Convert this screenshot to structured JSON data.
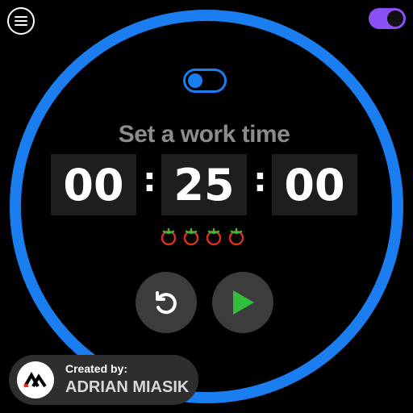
{
  "menu": {
    "icon": "hamburger-menu-icon"
  },
  "theme_toggle": {
    "state": "on",
    "color": "#8a4ff5"
  },
  "mode_toggle": {
    "state": "off",
    "color": "#1a7df0"
  },
  "timer": {
    "heading": "Set a work time",
    "hours": "00",
    "minutes": "25",
    "seconds": "00",
    "separator": ":"
  },
  "pomodoros": {
    "count": 4,
    "icon": "tomato-icon",
    "colors": {
      "fruit": "#e0301e",
      "leaf": "#2fbf3a"
    }
  },
  "controls": {
    "reset": {
      "icon": "reset-icon"
    },
    "play": {
      "icon": "play-icon",
      "color": "#2fbf3a"
    }
  },
  "credit": {
    "label": "Created by:",
    "author": "ADRIAN MIASIK",
    "logo": "am-logo-icon"
  },
  "colors": {
    "ring": "#1a7df0",
    "background": "#000000",
    "box": "#1e1e1e",
    "heading": "#8c8c8c"
  }
}
